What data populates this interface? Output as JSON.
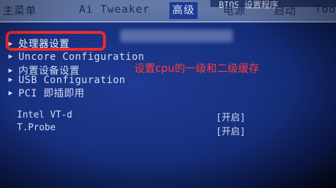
{
  "bios_title": "BIOS 设置程序",
  "menu": {
    "items": [
      {
        "label": "主菜单"
      },
      {
        "label": "Ai Tweaker"
      },
      {
        "label": "高级"
      },
      {
        "label": "电源"
      },
      {
        "label": "启动"
      },
      {
        "label": "Too"
      }
    ]
  },
  "main": {
    "rows": [
      {
        "label": "处理器设置"
      },
      {
        "label": "Uncore Configuration"
      },
      {
        "label": "内置设备设置"
      },
      {
        "label": "USB Configuration"
      },
      {
        "label": "PCI 即插即用"
      }
    ],
    "settings": [
      {
        "label": "Intel VT-d",
        "value": "[开启]"
      },
      {
        "label": "T.Probe",
        "value": "[开启]"
      }
    ]
  },
  "annotation": "设置cpu的一级和二级缓存",
  "colors": {
    "background": "#1f3a93",
    "menubar": "#6a7fae",
    "text": "#d5dcf0",
    "highlight_box": "#ee2a2a",
    "annotation": "#ff3b3b"
  }
}
